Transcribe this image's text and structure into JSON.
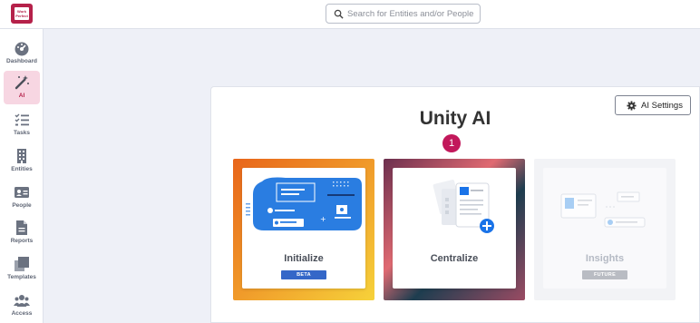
{
  "app": {
    "logo_text": "Work Perfect",
    "search_placeholder": "Search for Entities and/or People"
  },
  "sidebar": {
    "items": [
      {
        "label": "Dashboard",
        "icon": "dashboard-icon"
      },
      {
        "label": "AI",
        "icon": "magic-wand-icon",
        "active": true
      },
      {
        "label": "Tasks",
        "icon": "tasks-icon"
      },
      {
        "label": "Entities",
        "icon": "building-icon"
      },
      {
        "label": "People",
        "icon": "id-card-icon"
      },
      {
        "label": "Reports",
        "icon": "document-icon"
      },
      {
        "label": "Templates",
        "icon": "templates-icon"
      },
      {
        "label": "Access",
        "icon": "users-icon"
      }
    ]
  },
  "main": {
    "title": "Unity AI",
    "settings_label": "AI Settings",
    "step_badge": "1",
    "cards": [
      {
        "label": "Initialize",
        "badge": "BETA",
        "badge_color": "#3467c8"
      },
      {
        "label": "Centralize",
        "badge": "",
        "badge_color": ""
      },
      {
        "label": "Insights",
        "badge": "FUTURE",
        "badge_color": "#b9bcc3"
      }
    ]
  },
  "colors": {
    "brand": "#b5214a",
    "active_nav_bg": "#f7d6e2",
    "accent_blue": "#1a73e8"
  }
}
